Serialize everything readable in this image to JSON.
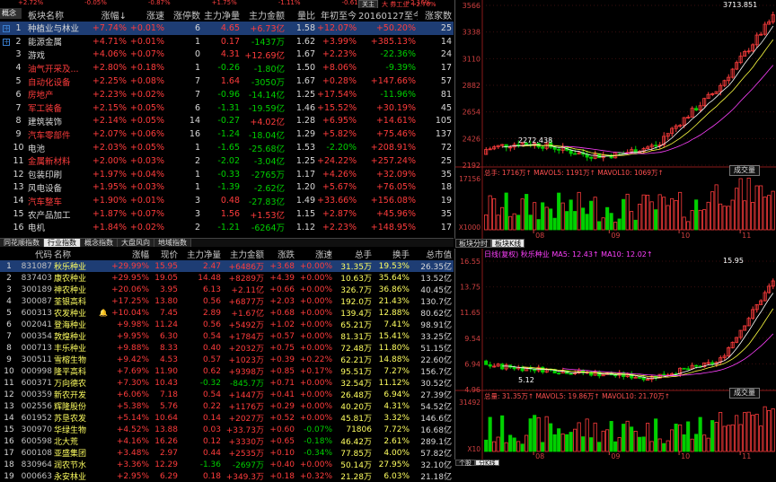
{
  "top_strip": [
    "+2.72%",
    "-0.05%",
    "-0.87%",
    "+1.75%",
    "-1.11%",
    "-0.61%",
    "+2.16%"
  ],
  "top_right": {
    "btn": "关主",
    "text": "大 券工业 +2.76%"
  },
  "corner": "概念",
  "sector_headers": [
    "",
    "",
    "板块名称",
    "涨幅↓",
    "涨速",
    "涨停数",
    "主力净量",
    "主力金额",
    "量比",
    "年初至今",
    "20160127至今",
    "涨家数"
  ],
  "sectors": [
    {
      "n": "1",
      "name": "种植业与林业",
      "chg": "+7.74%",
      "speed": "+0.01%",
      "limit": "6",
      "net": "4.65",
      "amt": "+6.73亿",
      "vr": "1.58",
      "ytd": "+12.07%",
      "since": "+50.20%",
      "up": "25",
      "nc": "w"
    },
    {
      "n": "2",
      "name": "能源金属",
      "chg": "+4.71%",
      "speed": "+0.01%",
      "limit": "1",
      "net": "0.17",
      "amt": "-1437万",
      "vr": "1.62",
      "ytd": "+3.99%",
      "since": "+385.13%",
      "up": "14",
      "nc": "w"
    },
    {
      "n": "3",
      "name": "游戏",
      "chg": "+4.06%",
      "speed": "+0.07%",
      "limit": "0",
      "net": "4.31",
      "amt": "+12.69亿",
      "vr": "1.67",
      "ytd": "+2.23%",
      "since": "-22.36%",
      "up": "24",
      "nc": "w"
    },
    {
      "n": "4",
      "name": "油气开采及...",
      "chg": "+2.80%",
      "speed": "+0.18%",
      "limit": "1",
      "net": "-0.26",
      "amt": "-1.80亿",
      "vr": "1.50",
      "ytd": "+8.06%",
      "since": "-9.39%",
      "up": "17",
      "nc": "r"
    },
    {
      "n": "5",
      "name": "自动化设备",
      "chg": "+2.25%",
      "speed": "+0.08%",
      "limit": "7",
      "net": "1.64",
      "amt": "-3050万",
      "vr": "1.67",
      "ytd": "+0.28%",
      "since": "+147.66%",
      "up": "57",
      "nc": "r"
    },
    {
      "n": "6",
      "name": "房地产",
      "chg": "+2.23%",
      "speed": "+0.02%",
      "limit": "7",
      "net": "-0.96",
      "amt": "-14.14亿",
      "vr": "1.25",
      "ytd": "+17.54%",
      "since": "-11.96%",
      "up": "81",
      "nc": "r"
    },
    {
      "n": "7",
      "name": "军工装备",
      "chg": "+2.15%",
      "speed": "+0.05%",
      "limit": "6",
      "net": "-1.31",
      "amt": "-19.59亿",
      "vr": "1.46",
      "ytd": "+15.52%",
      "since": "+30.19%",
      "up": "45",
      "nc": "r"
    },
    {
      "n": "8",
      "name": "建筑装饰",
      "chg": "+2.14%",
      "speed": "+0.05%",
      "limit": "14",
      "net": "-0.27",
      "amt": "+4.02亿",
      "vr": "1.28",
      "ytd": "+6.95%",
      "since": "+14.61%",
      "up": "105",
      "nc": "w"
    },
    {
      "n": "9",
      "name": "汽车零部件",
      "chg": "+2.07%",
      "speed": "+0.06%",
      "limit": "16",
      "net": "-1.24",
      "amt": "-18.04亿",
      "vr": "1.29",
      "ytd": "+5.82%",
      "since": "+75.46%",
      "up": "137",
      "nc": "r"
    },
    {
      "n": "10",
      "name": "电池",
      "chg": "+2.03%",
      "speed": "+0.05%",
      "limit": "1",
      "net": "-1.65",
      "amt": "-25.68亿",
      "vr": "1.53",
      "ytd": "-2.20%",
      "since": "+208.91%",
      "up": "72",
      "nc": "w"
    },
    {
      "n": "11",
      "name": "金属新材料",
      "chg": "+2.00%",
      "speed": "+0.03%",
      "limit": "2",
      "net": "-2.02",
      "amt": "-3.04亿",
      "vr": "1.25",
      "ytd": "+24.22%",
      "since": "+257.24%",
      "up": "25",
      "nc": "r"
    },
    {
      "n": "12",
      "name": "包装印刷",
      "chg": "+1.97%",
      "speed": "+0.04%",
      "limit": "1",
      "net": "-0.33",
      "amt": "-2765万",
      "vr": "1.17",
      "ytd": "+4.26%",
      "since": "+32.09%",
      "up": "35",
      "nc": "w"
    },
    {
      "n": "13",
      "name": "风电设备",
      "chg": "+1.95%",
      "speed": "+0.03%",
      "limit": "1",
      "net": "-1.39",
      "amt": "-2.62亿",
      "vr": "1.20",
      "ytd": "+5.67%",
      "since": "+76.05%",
      "up": "18",
      "nc": "w"
    },
    {
      "n": "14",
      "name": "汽车整车",
      "chg": "+1.90%",
      "speed": "+0.01%",
      "limit": "3",
      "net": "0.48",
      "amt": "-27.83亿",
      "vr": "1.49",
      "ytd": "+33.66%",
      "since": "+156.08%",
      "up": "19",
      "nc": "r"
    },
    {
      "n": "15",
      "name": "农产品加工",
      "chg": "+1.87%",
      "speed": "+0.07%",
      "limit": "3",
      "net": "1.56",
      "amt": "+1.53亿",
      "vr": "1.15",
      "ytd": "+2.87%",
      "since": "+45.96%",
      "up": "35",
      "nc": "w"
    },
    {
      "n": "16",
      "name": "电机",
      "chg": "+1.84%",
      "speed": "+0.02%",
      "limit": "2",
      "net": "-1.21",
      "amt": "-6264万",
      "vr": "1.12",
      "ytd": "+2.23%",
      "since": "+148.95%",
      "up": "17",
      "nc": "w"
    }
  ],
  "tabs": [
    "同花顺指数",
    "行业指数",
    "概念指数",
    "大盘风向",
    "地域指数"
  ],
  "active_tab": 1,
  "stock_headers": [
    "",
    "代码",
    "名称",
    "",
    "涨幅",
    "现价",
    "主力净量",
    "主力金额",
    "涨跌",
    "涨速",
    "总手",
    "换手",
    "总市值"
  ],
  "stocks": [
    {
      "n": "1",
      "code": "831087",
      "name": "秋乐种业",
      "flag": "",
      "chg": "+29.99%",
      "price": "15.95",
      "net": "2.47",
      "amt": "+6486万",
      "diff": "+3.68",
      "speed": "+0.00%",
      "vol": "31.35万",
      "turn": "19.53%",
      "cap": "26.35亿"
    },
    {
      "n": "2",
      "code": "837403",
      "name": "康农种业",
      "flag": "",
      "chg": "+29.95%",
      "price": "19.05",
      "net": "14.48",
      "amt": "+8289万",
      "diff": "+4.39",
      "speed": "+0.00%",
      "vol": "10.63万",
      "turn": "35.64%",
      "cap": "13.52亿"
    },
    {
      "n": "3",
      "code": "300189",
      "name": "神农种业",
      "flag": "",
      "chg": "+20.06%",
      "price": "3.95",
      "net": "6.13",
      "amt": "+2.11亿",
      "diff": "+0.66",
      "speed": "+0.00%",
      "vol": "326.7万",
      "turn": "36.86%",
      "cap": "40.45亿"
    },
    {
      "n": "4",
      "code": "300087",
      "name": "荃银高科",
      "flag": "",
      "chg": "+17.25%",
      "price": "13.80",
      "net": "0.56",
      "amt": "+6877万",
      "diff": "+2.03",
      "speed": "+0.00%",
      "vol": "192.0万",
      "turn": "21.43%",
      "cap": "130.7亿"
    },
    {
      "n": "5",
      "code": "600313",
      "name": "农发种业",
      "flag": "🔔",
      "chg": "+10.04%",
      "price": "7.45",
      "net": "2.89",
      "amt": "+1.67亿",
      "diff": "+0.68",
      "speed": "+0.00%",
      "vol": "139.4万",
      "turn": "12.88%",
      "cap": "80.62亿"
    },
    {
      "n": "6",
      "code": "002041",
      "name": "登海种业",
      "flag": "",
      "chg": "+9.98%",
      "price": "11.24",
      "net": "0.56",
      "amt": "+5492万",
      "diff": "+1.02",
      "speed": "+0.00%",
      "vol": "65.21万",
      "turn": "7.41%",
      "cap": "98.91亿"
    },
    {
      "n": "7",
      "code": "000354",
      "name": "敦煌种业",
      "flag": "",
      "chg": "+9.95%",
      "price": "6.30",
      "net": "0.54",
      "amt": "+1784万",
      "diff": "+0.57",
      "speed": "+0.00%",
      "vol": "81.31万",
      "turn": "15.41%",
      "cap": "33.25亿"
    },
    {
      "n": "8",
      "code": "000713",
      "name": "丰乐种业",
      "flag": "",
      "chg": "+9.88%",
      "price": "8.33",
      "net": "0.40",
      "amt": "+2032万",
      "diff": "+0.75",
      "speed": "+0.00%",
      "vol": "72.48万",
      "turn": "11.80%",
      "cap": "51.15亿"
    },
    {
      "n": "9",
      "code": "300511",
      "name": "雪榕生物",
      "flag": "",
      "chg": "+9.42%",
      "price": "4.53",
      "net": "0.57",
      "amt": "+1023万",
      "diff": "+0.39",
      "speed": "+0.22%",
      "vol": "62.21万",
      "turn": "14.88%",
      "cap": "22.60亿"
    },
    {
      "n": "10",
      "code": "000998",
      "name": "隆平高科",
      "flag": "",
      "chg": "+7.69%",
      "price": "11.90",
      "net": "0.62",
      "amt": "+9398万",
      "diff": "+0.85",
      "speed": "+0.17%",
      "vol": "95.51万",
      "turn": "7.27%",
      "cap": "156.7亿"
    },
    {
      "n": "11",
      "code": "600371",
      "name": "万向德农",
      "flag": "",
      "chg": "+7.30%",
      "price": "10.43",
      "net": "-0.32",
      "amt": "-845.7万",
      "diff": "+0.71",
      "speed": "+0.00%",
      "vol": "32.54万",
      "turn": "11.12%",
      "cap": "30.52亿"
    },
    {
      "n": "12",
      "code": "000359",
      "name": "新农开发",
      "flag": "",
      "chg": "+6.06%",
      "price": "7.18",
      "net": "0.54",
      "amt": "+1447万",
      "diff": "+0.41",
      "speed": "+0.00%",
      "vol": "26.48万",
      "turn": "6.94%",
      "cap": "27.39亿"
    },
    {
      "n": "13",
      "code": "002556",
      "name": "辉隆股份",
      "flag": "",
      "chg": "+5.38%",
      "price": "5.76",
      "net": "0.22",
      "amt": "+1176万",
      "diff": "+0.29",
      "speed": "+0.00%",
      "vol": "40.20万",
      "turn": "4.31%",
      "cap": "54.52亿"
    },
    {
      "n": "14",
      "code": "601952",
      "name": "苏垦农发",
      "flag": "",
      "chg": "+5.14%",
      "price": "10.64",
      "net": "0.14",
      "amt": "+2027万",
      "diff": "+0.52",
      "speed": "+0.00%",
      "vol": "45.81万",
      "turn": "3.32%",
      "cap": "146.6亿"
    },
    {
      "n": "15",
      "code": "300970",
      "name": "华绿生物",
      "flag": "",
      "chg": "+4.52%",
      "price": "13.88",
      "net": "0.03",
      "amt": "+33.73万",
      "diff": "+0.60",
      "speed": "-0.07%",
      "vol": "71806",
      "turn": "7.72%",
      "cap": "16.68亿"
    },
    {
      "n": "16",
      "code": "600598",
      "name": "北大荒",
      "flag": "",
      "chg": "+4.16%",
      "price": "16.26",
      "net": "0.12",
      "amt": "+3330万",
      "diff": "+0.65",
      "speed": "-0.18%",
      "vol": "46.42万",
      "turn": "2.61%",
      "cap": "289.1亿"
    },
    {
      "n": "17",
      "code": "600108",
      "name": "亚盛集团",
      "flag": "",
      "chg": "+3.48%",
      "price": "2.97",
      "net": "0.44",
      "amt": "+2535万",
      "diff": "+0.10",
      "speed": "-0.34%",
      "vol": "77.85万",
      "turn": "4.00%",
      "cap": "57.82亿"
    },
    {
      "n": "18",
      "code": "830964",
      "name": "润农节水",
      "flag": "",
      "chg": "+3.36%",
      "price": "12.29",
      "net": "-1.36",
      "amt": "-2697万",
      "diff": "+0.40",
      "speed": "+0.00%",
      "vol": "50.14万",
      "turn": "27.95%",
      "cap": "32.10亿"
    },
    {
      "n": "19",
      "code": "000663",
      "name": "永安林业",
      "flag": "",
      "chg": "+2.95%",
      "price": "6.29",
      "net": "0.18",
      "amt": "+349.3万",
      "diff": "+0.18",
      "speed": "+0.32%",
      "vol": "21.28万",
      "turn": "6.03%",
      "cap": "21.18亿"
    }
  ],
  "chart1": {
    "y_ticks": [
      "3566",
      "3338",
      "3110",
      "2882",
      "2654",
      "2426",
      "2192"
    ],
    "high_label": "3713.851",
    "low_label": "2272.438",
    "vol_label": "总手: 1716万↑ MAVOL5: 1191万↑ MAVOL10: 1069万↑",
    "vol_btn": "成交量",
    "vol_ticks": [
      "17156",
      "X1000"
    ],
    "months": [
      "08",
      "09",
      "10",
      "11"
    ]
  },
  "chart_tabs": [
    "板块分时",
    "板块K线"
  ],
  "chart2": {
    "legend": "日线(复权) 秋乐种业 MA5: 12.43↑ MA10: 12.02↑",
    "y_ticks": [
      "16.55",
      "13.75",
      "11.65",
      "9.54",
      "6.94",
      "4.96"
    ],
    "high_label": "15.95",
    "low_label": "5.12",
    "vol_label": "总量: 31.35万↑ MAVOL5: 19.86万↑ MAVOL10: 21.70万↑",
    "vol_btn": "成交量",
    "vol_ticks": [
      "31492",
      "X10"
    ],
    "months": [
      "08",
      "09",
      "10",
      "11"
    ]
  },
  "bottom_tabs": [
    "个股",
    "分K线"
  ],
  "colors": {
    "up": "#ff3c3c",
    "down": "#00d000",
    "select": "#1e3d74",
    "yellow": "#ffff60"
  }
}
